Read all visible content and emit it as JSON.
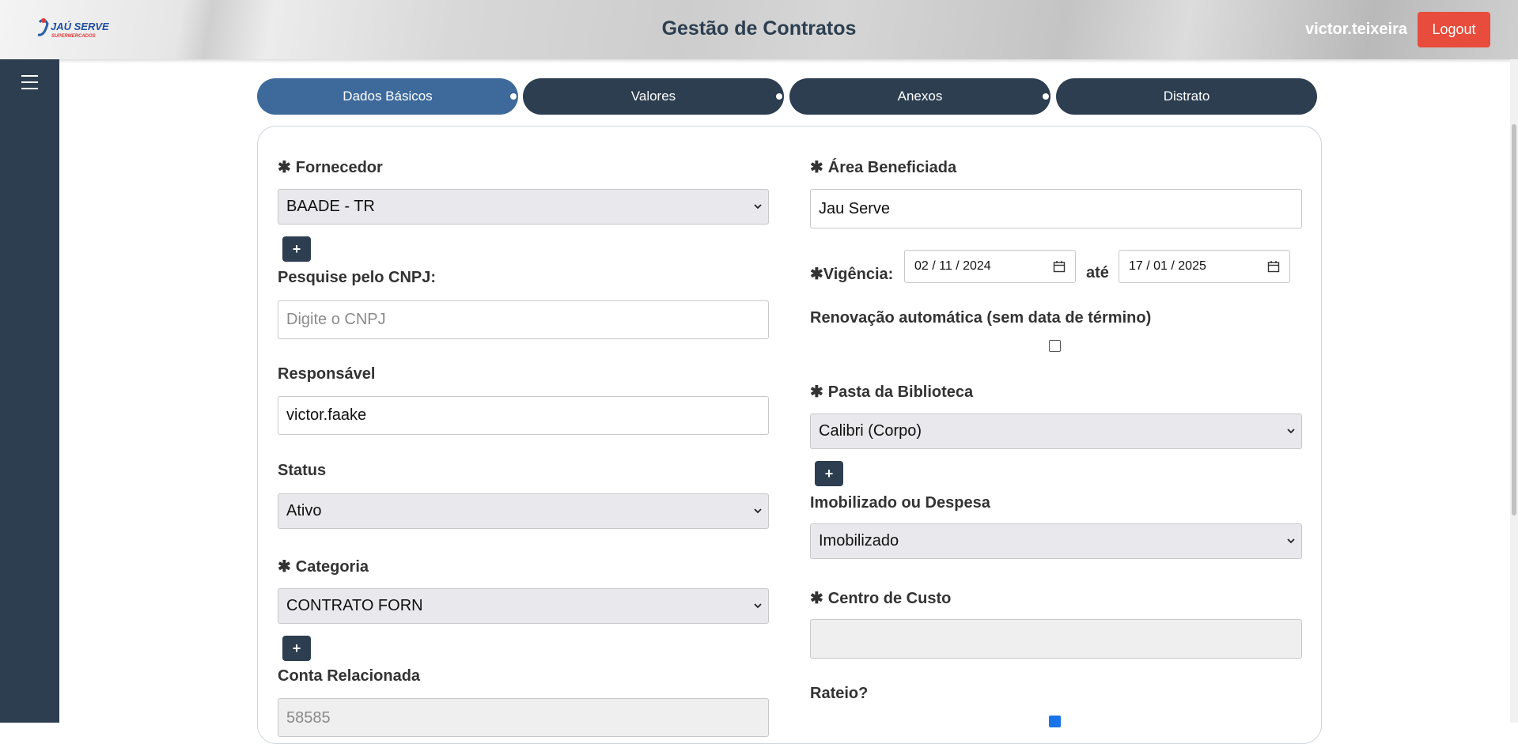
{
  "header": {
    "logo_text": "JAÚ SERVE",
    "logo_subtext": "SUPERMERCADOS",
    "title": "Gestão de Contratos",
    "username": "victor.teixeira",
    "logout_label": "Logout"
  },
  "tabs": [
    {
      "label": "Dados Básicos",
      "active": true
    },
    {
      "label": "Valores",
      "active": false
    },
    {
      "label": "Anexos",
      "active": false
    },
    {
      "label": "Distrato",
      "active": false
    }
  ],
  "form": {
    "required_mark": "✱",
    "fornecedor": {
      "label": "Fornecedor",
      "value": "BAADE - TR"
    },
    "cnpj": {
      "label": "Pesquise pelo CNPJ:",
      "placeholder": "Digite o CNPJ"
    },
    "responsavel": {
      "label": "Responsável",
      "value": "victor.faake"
    },
    "status": {
      "label": "Status",
      "value": "Ativo"
    },
    "categoria": {
      "label": "Categoria",
      "value": "CONTRATO FORN"
    },
    "conta": {
      "label": "Conta Relacionada",
      "value": "58585"
    },
    "area": {
      "label": "Área Beneficiada",
      "value": "Jau Serve"
    },
    "vigencia": {
      "label": "Vigência:",
      "start": "02 / 11 / 2024",
      "separator": "até",
      "end": "17 / 01 / 2025"
    },
    "renovacao": {
      "label": "Renovação automática (sem data de término)",
      "checked": false
    },
    "pasta": {
      "label": "Pasta da Biblioteca",
      "value": "Calibri (Corpo)"
    },
    "imobilizado": {
      "label": "Imobilizado ou Despesa",
      "value": "Imobilizado"
    },
    "centro_custo": {
      "label": "Centro de Custo",
      "value": ""
    },
    "rateio": {
      "label": "Rateio?",
      "checked": true
    },
    "plus_label": "+"
  },
  "colors": {
    "navy": "#2c3e50",
    "active_tab": "#3d6a9b",
    "logout": "#e74c3c"
  }
}
